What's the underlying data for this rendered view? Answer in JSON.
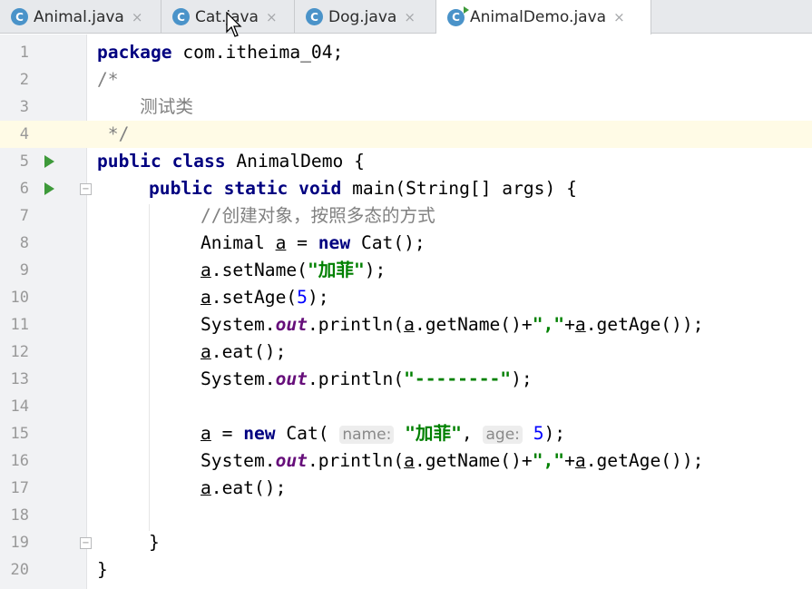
{
  "tabs": [
    {
      "label": "Animal.java",
      "icon": "class-icon",
      "icon_text": "C",
      "close": "×"
    },
    {
      "label": "Cat.java",
      "icon": "class-icon",
      "icon_text": "C",
      "close": "×"
    },
    {
      "label": "Dog.java",
      "icon": "class-icon",
      "icon_text": "C",
      "close": "×"
    },
    {
      "label": "AnimalDemo.java",
      "icon": "class-run-icon",
      "icon_text": "C",
      "close": "×",
      "active": true
    }
  ],
  "editor": {
    "line_numbers": [
      "1",
      "2",
      "3",
      "4",
      "5",
      "6",
      "7",
      "8",
      "9",
      "10",
      "11",
      "12",
      "13",
      "14",
      "15",
      "16",
      "17",
      "18",
      "19",
      "20"
    ],
    "current_line": 4,
    "code": {
      "l1": {
        "kw": "package",
        "rest": " com.itheima_04;"
      },
      "l2": {
        "comment": "/*"
      },
      "l3": {
        "comment": "    测试类"
      },
      "l4": {
        "comment": " */"
      },
      "l5": {
        "kw1": "public",
        "kw2": "class",
        "rest": " AnimalDemo {"
      },
      "l6": {
        "kw1": "public",
        "kw2": "static",
        "kw3": "void",
        "rest": " main(String[] args) {"
      },
      "l7": {
        "comment": "//创建对象，按照多态的方式"
      },
      "l8": {
        "type": "Animal ",
        "var": "a",
        "eq": " = ",
        "kw": "new",
        "rest": " Cat();"
      },
      "l9": {
        "var": "a",
        "call": ".setName(",
        "str": "\"加菲\"",
        "end": ");"
      },
      "l10": {
        "var": "a",
        "call": ".setAge(",
        "num": "5",
        "end": ");"
      },
      "l11": {
        "sys": "System.",
        "field": "out",
        "call": ".println(",
        "var1": "a",
        "mid1": ".getName()+",
        "str": "\",\"",
        "plus": "+",
        "var2": "a",
        "end": ".getAge());"
      },
      "l12": {
        "var": "a",
        "end": ".eat();"
      },
      "l13": {
        "sys": "System.",
        "field": "out",
        "call": ".println(",
        "str": "\"--------\"",
        "end": ");"
      },
      "l15": {
        "var": "a",
        "eq": " = ",
        "kw": "new",
        "call": " Cat( ",
        "hint1": "name:",
        "str": "\"加菲\"",
        "comma": ", ",
        "hint2": "age:",
        "num": "5",
        "end": ");"
      },
      "l16": {
        "sys": "System.",
        "field": "out",
        "call": ".println(",
        "var1": "a",
        "mid1": ".getName()+",
        "str": "\",\"",
        "plus": "+",
        "var2": "a",
        "end": ".getAge());"
      },
      "l17": {
        "var": "a",
        "end": ".eat();"
      },
      "l19": {
        "rest": "}"
      },
      "l20": {
        "rest": "}"
      }
    }
  },
  "colors": {
    "keyword": "#000080",
    "string": "#008000",
    "number": "#0000ff",
    "comment": "#808080",
    "static_field": "#660e7a",
    "run_icon": "#3e9a3a",
    "current_line_bg": "#fffbe6"
  }
}
